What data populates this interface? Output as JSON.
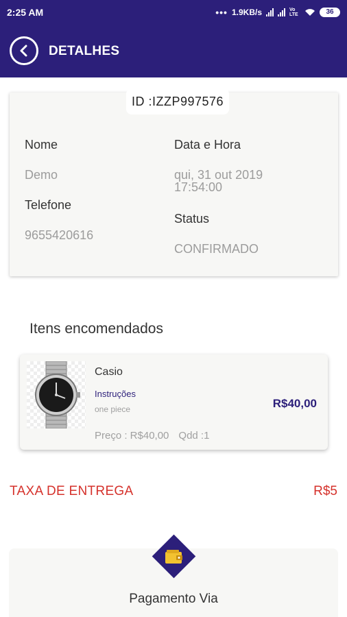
{
  "status_bar": {
    "time": "2:25 AM",
    "network_speed": "1.9KB/s",
    "volte": "Vo LTE",
    "battery": "36"
  },
  "header": {
    "title": "DETALHES",
    "back_icon": "back-arrow-circle-icon"
  },
  "order": {
    "id_text": "ID :IZZP997576",
    "name_label": "Nome",
    "name_value": "Demo",
    "phone_label": "Telefone",
    "phone_value": "9655420616",
    "datetime_label": "Data e Hora",
    "datetime_line1": "qui, 31 out 2019",
    "datetime_line2": "17:54:00",
    "status_label": "Status",
    "status_value": "CONFIRMADO"
  },
  "items_section": {
    "title": "Itens encomendados",
    "items": [
      {
        "name": "Casio",
        "instructions_label": "Instruções",
        "instructions_note": "one piece",
        "price_text": "Preço : R$40,00",
        "qty_text": "Qdd :1",
        "total": "R$40,00",
        "image_icon": "wristwatch-image"
      }
    ]
  },
  "delivery_fee": {
    "label": "TAXA DE ENTREGA",
    "value": "R$5"
  },
  "payment": {
    "title": "Pagamento Via",
    "icon": "wallet-icon"
  },
  "colors": {
    "primary": "#2c1f7a",
    "accent_red": "#d5312b",
    "card_bg": "#f7f7f5"
  }
}
